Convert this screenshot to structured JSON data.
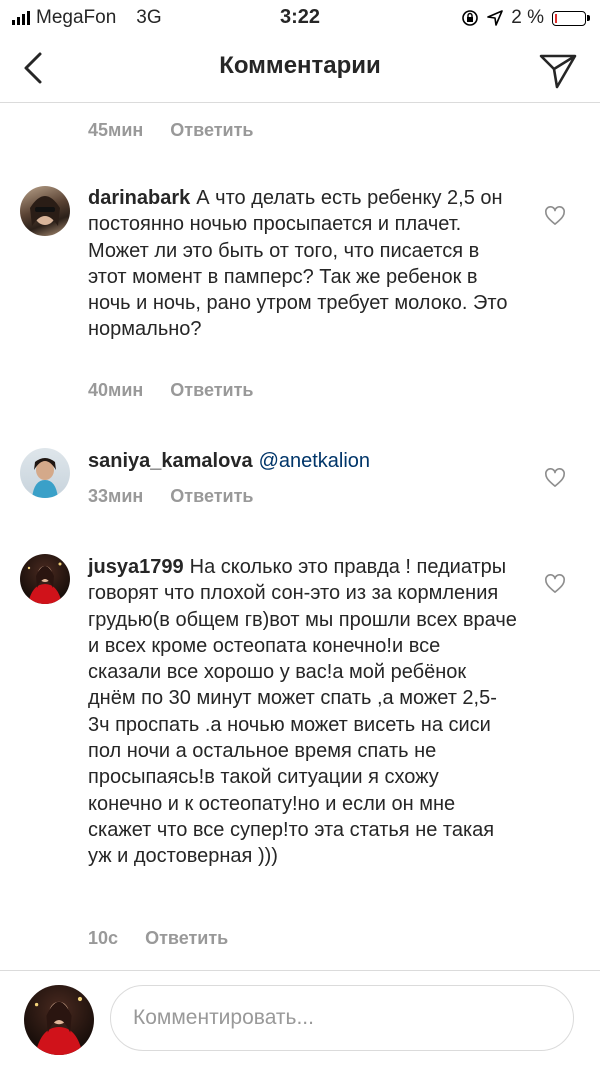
{
  "status_bar": {
    "carrier": "MegaFon",
    "network": "3G",
    "time": "3:22",
    "battery": "2 %"
  },
  "header": {
    "title": "Комментарии"
  },
  "comments": [
    {
      "username": "",
      "text": "",
      "time": "45мин",
      "reply_label": "Ответить"
    },
    {
      "username": "darinabark",
      "text": "А что делать есть ребенку 2,5 он постоянно ночью просыпается и плачет. Может ли это быть от того, что писается в этот момент в памперс? Так же ребенок в ночь и ночь, рано утром требует молоко. Это нормально?",
      "time": "40мин",
      "reply_label": "Ответить"
    },
    {
      "username": "saniya_kamalova",
      "mention": "@anetkalion",
      "time": "33мин",
      "reply_label": "Ответить"
    },
    {
      "username": "jusya1799",
      "text": "На сколько это правда ! педиатры говорят что плохой сон-это из за кормления грудью(в общем гв)вот мы прошли всех враче и всех кроме остеопата конечно!и все сказали все хорошо у вас!а мой ребёнок днём по 30 минут может спать ,а может 2,5-3ч проспать .а ночью может висеть на сиси пол ночи а остальное время спать не просыпаясь!в такой ситуации я схожу конечно и к остеопату!но и если он мне скажет что все супер!то эта статья не такая уж и достоверная )))",
      "time": "10с",
      "reply_label": "Ответить"
    }
  ],
  "composer": {
    "placeholder": "Комментировать..."
  },
  "icons": {
    "back": "chevron-left-icon",
    "send": "paper-plane-icon",
    "like": "heart-icon",
    "location": "location-arrow-icon",
    "lock": "rotation-lock-icon"
  }
}
